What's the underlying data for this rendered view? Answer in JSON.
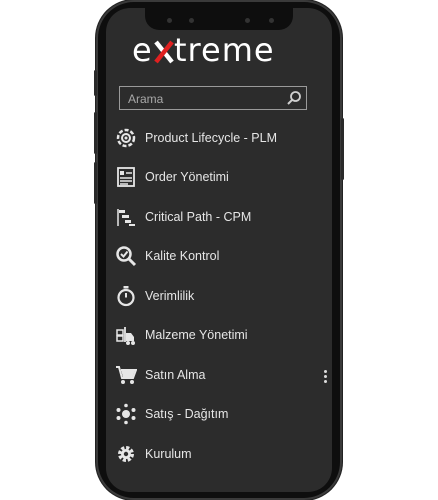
{
  "app": {
    "logo_text": "extreme"
  },
  "search": {
    "placeholder": "Arama",
    "icon": "search-icon"
  },
  "menu": {
    "items": [
      {
        "label": "Product Lifecycle - PLM",
        "icon": "gear-target-icon"
      },
      {
        "label": "Order Yönetimi",
        "icon": "order-document-icon"
      },
      {
        "label": "Critical Path - CPM",
        "icon": "gantt-icon"
      },
      {
        "label": "Kalite Kontrol",
        "icon": "quality-check-icon"
      },
      {
        "label": "Verimlilik",
        "icon": "stopwatch-icon"
      },
      {
        "label": "Malzeme Yönetimi",
        "icon": "forklift-icon"
      },
      {
        "label": "Satın Alma",
        "icon": "shopping-cart-icon"
      },
      {
        "label": "Satış - Dağıtım",
        "icon": "distribution-icon"
      },
      {
        "label": "Kurulum",
        "icon": "settings-gear-icon"
      }
    ]
  },
  "colors": {
    "screen_bg": "#2c2c2c",
    "text": "#e6e6e6",
    "accent": "#e02020"
  }
}
